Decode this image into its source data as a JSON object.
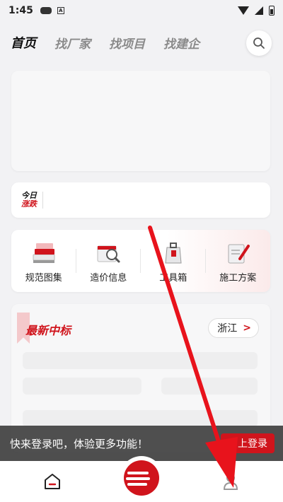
{
  "status": {
    "time": "1:45"
  },
  "nav": {
    "tabs": [
      "首页",
      "找厂家",
      "找项目",
      "找建企"
    ]
  },
  "ticker": {
    "badge_line1": "今日",
    "badge_line2": "涨跌"
  },
  "tools": [
    {
      "label": "规范图集",
      "icon": "books-icon"
    },
    {
      "label": "造价信息",
      "icon": "price-magnifier-icon"
    },
    {
      "label": "工具箱",
      "icon": "toolbox-icon"
    },
    {
      "label": "施工方案",
      "icon": "document-pen-icon"
    }
  ],
  "bids": {
    "title": "最新中标",
    "region": "浙江"
  },
  "login": {
    "prompt": "快来登录吧，体验更多功能！",
    "button": "马上登录"
  },
  "colors": {
    "accent": "#d0141c"
  }
}
